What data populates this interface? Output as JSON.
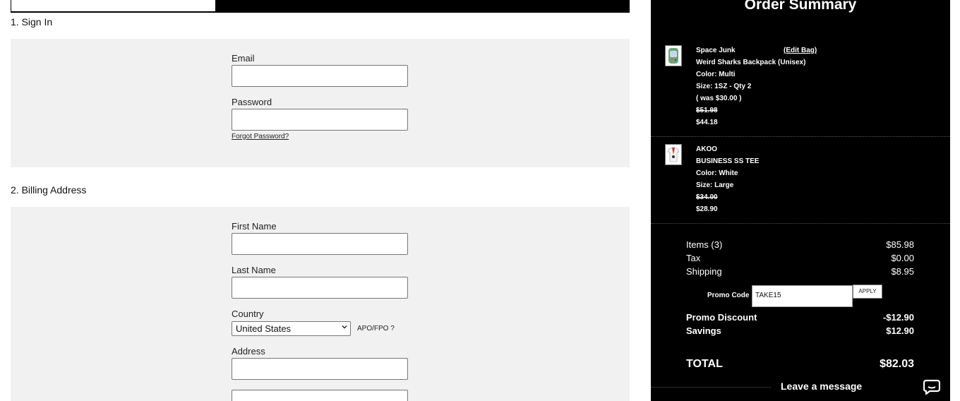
{
  "signin": {
    "title": "1. Sign In",
    "email_label": "Email",
    "email_value": "",
    "password_label": "Password",
    "password_value": "",
    "forgot_link": "Forgot Password?"
  },
  "billing": {
    "title": "2. Billing Address",
    "first_name_label": "First Name",
    "first_name_value": "",
    "last_name_label": "Last Name",
    "last_name_value": "",
    "country_label": "Country",
    "country_value": "United States",
    "apo_label": "APO/FPO ?",
    "address_label": "Address",
    "address_value": ""
  },
  "summary": {
    "title": "Order Summary",
    "items": [
      {
        "brand": "Space Junk",
        "edit": "(Edit Bag)",
        "name": "Weird Sharks Backpack (Unisex)",
        "color": "Color: Multi",
        "size": "Size: 1SZ - Qty 2",
        "was": "( was $30.00 )",
        "old_price": "$51.98",
        "price": "$44.18"
      },
      {
        "brand": "AKOO",
        "name": "BUSINESS SS TEE",
        "color": "Color: White",
        "size": "Size: Large",
        "old_price": "$34.00",
        "price": "$28.90"
      }
    ],
    "items_label": "Items (3)",
    "items_value": "$85.98",
    "tax_label": "Tax",
    "tax_value": "$0.00",
    "shipping_label": "Shipping",
    "shipping_value": "$8.95",
    "promo_label": "Promo Code",
    "promo_value": "TAKE15",
    "apply_label": "APPLY",
    "discount_label": "Promo Discount",
    "discount_value": "-$12.90",
    "savings_label": "Savings",
    "savings_value": "$12.90",
    "total_label": "TOTAL",
    "total_value": "$82.03"
  },
  "chat": {
    "label": "Leave a message"
  }
}
